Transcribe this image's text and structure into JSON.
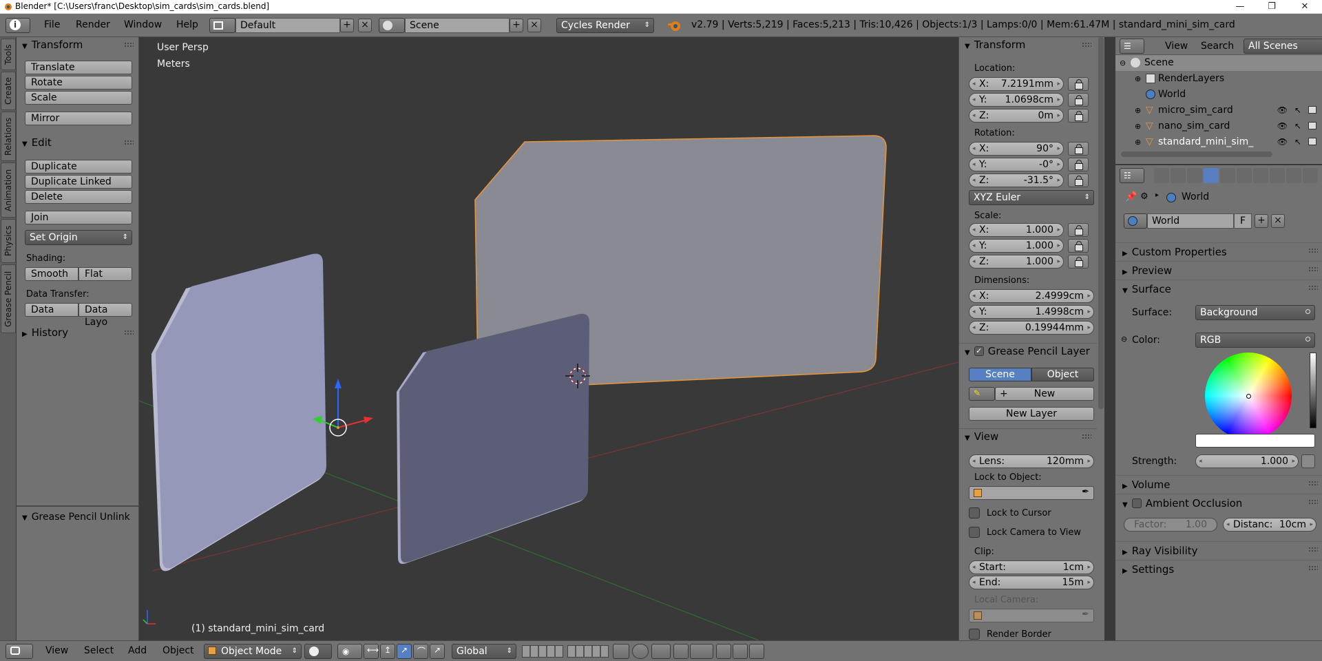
{
  "window": {
    "title": "Blender* [C:\\Users\\franc\\Desktop\\sim_cards\\sim_cards.blend]",
    "controls": [
      "—",
      "❐",
      "✕"
    ]
  },
  "topbar": {
    "menus": [
      "File",
      "Render",
      "Window",
      "Help"
    ],
    "screen_layout": "Default",
    "scene": "Scene",
    "engine": "Cycles Render",
    "stats": "v2.79 | Verts:5,219 | Faces:5,213 | Tris:10,426 | Objects:1/3 | Lamps:0/0 | Mem:61.47M | standard_mini_sim_card"
  },
  "left_tabs": [
    "Tools",
    "Create",
    "Relations",
    "Animation",
    "Physics",
    "Grease Pencil"
  ],
  "toolshelf": {
    "transform": {
      "title": "Transform",
      "buttons": [
        "Translate",
        "Rotate",
        "Scale",
        "Mirror"
      ]
    },
    "edit": {
      "title": "Edit",
      "buttons": [
        "Duplicate",
        "Duplicate Linked",
        "Delete",
        "Join"
      ],
      "set_origin": "Set Origin",
      "shading_label": "Shading:",
      "shading": [
        "Smooth",
        "Flat"
      ],
      "data_transfer_label": "Data Transfer:",
      "data_transfer": [
        "Data",
        "Data Layo"
      ]
    },
    "history": "History",
    "operator_panel": "Grease Pencil Unlink"
  },
  "viewport": {
    "view_name": "User Persp",
    "units": "Meters",
    "active_object": "(1) standard_mini_sim_card",
    "colors": {
      "background": "#393939",
      "card_light": "#9598b8",
      "card_dark": "#5c5e78",
      "card_mid": "#808088",
      "selection": "#e8953a"
    }
  },
  "npanel": {
    "transform_title": "Transform",
    "location_label": "Location:",
    "location": [
      {
        "axis": "X:",
        "value": "7.2191mm"
      },
      {
        "axis": "Y:",
        "value": "1.0698cm"
      },
      {
        "axis": "Z:",
        "value": "0m"
      }
    ],
    "rotation_label": "Rotation:",
    "rotation": [
      {
        "axis": "X:",
        "value": "90°"
      },
      {
        "axis": "Y:",
        "value": "-0°"
      },
      {
        "axis": "Z:",
        "value": "-31.5°"
      }
    ],
    "rotation_mode": "XYZ Euler",
    "scale_label": "Scale:",
    "scale": [
      {
        "axis": "X:",
        "value": "1.000"
      },
      {
        "axis": "Y:",
        "value": "1.000"
      },
      {
        "axis": "Z:",
        "value": "1.000"
      }
    ],
    "dimensions_label": "Dimensions:",
    "dimensions": [
      {
        "axis": "X:",
        "value": "2.4999cm"
      },
      {
        "axis": "Y:",
        "value": "1.4998cm"
      },
      {
        "axis": "Z:",
        "value": "0.19944mm"
      }
    ],
    "grease_pencil": {
      "title": "Grease Pencil Layer",
      "tabs": [
        "Scene",
        "Object"
      ],
      "new_label": "New",
      "new_layer_label": "New Layer"
    },
    "view": {
      "title": "View",
      "lens_label": "Lens:",
      "lens_value": "120mm",
      "lock_to_object_label": "Lock to Object:",
      "lock_to_cursor": "Lock to Cursor",
      "lock_camera": "Lock Camera to View",
      "clip_label": "Clip:",
      "clip_start_label": "Start:",
      "clip_start": "1cm",
      "clip_end_label": "End:",
      "clip_end": "15m",
      "local_camera_label": "Local Camera:",
      "render_border": "Render Border"
    }
  },
  "outliner": {
    "header": {
      "view": "View",
      "search": "Search",
      "filter": "All Scenes"
    },
    "items": [
      {
        "name": "Scene",
        "level": 0
      },
      {
        "name": "RenderLayers",
        "level": 1
      },
      {
        "name": "World",
        "level": 1
      },
      {
        "name": "micro_sim_card",
        "level": 1
      },
      {
        "name": "nano_sim_card",
        "level": 1
      },
      {
        "name": "standard_mini_sim_",
        "level": 1
      }
    ]
  },
  "properties": {
    "breadcrumb": "World",
    "world_name": "World",
    "world_fake_user": "F",
    "sections": {
      "custom_properties": "Custom Properties",
      "preview": "Preview",
      "surface": "Surface",
      "volume": "Volume",
      "ambient_occlusion": "Ambient Occlusion",
      "ray_visibility": "Ray Visibility",
      "settings": "Settings"
    },
    "surface_label": "Surface:",
    "surface_value": "Background",
    "color_label": "Color:",
    "color_value": "RGB",
    "strength_label": "Strength:",
    "strength_value": "1.000",
    "ao_factor_label": "Factor:",
    "ao_factor_value": "1.00",
    "ao_distance_label": "Distanc:",
    "ao_distance_value": "10cm"
  },
  "bottombar": {
    "menus": [
      "View",
      "Select",
      "Add",
      "Object"
    ],
    "mode": "Object Mode",
    "orientation": "Global"
  }
}
